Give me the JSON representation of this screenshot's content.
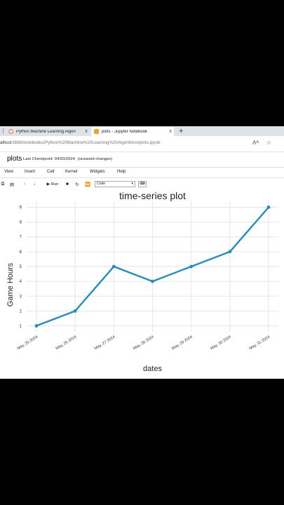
{
  "browser": {
    "tabs": [
      {
        "label": "Python Machine Learning Algori",
        "active": false
      },
      {
        "label": "plots - Jupyter Notebook",
        "active": true
      }
    ],
    "close_glyph": "x",
    "new_tab_glyph": "+",
    "url_prefix": "alhost",
    "url_path": ":8888/notebooks/Python%20Machine%20Learning%20Algorithms/plots.ipynb",
    "read_aloud_glyph": "Aᴬ",
    "favorite_glyph": "☆"
  },
  "notebook": {
    "name": "plots",
    "checkpoint": "Last Checkpoint: 04/20/2024",
    "status": "(unsaved changes)"
  },
  "menu": [
    "View",
    "Insert",
    "Cell",
    "Kernel",
    "Widgets",
    "Help"
  ],
  "toolbar": {
    "run_label": "Run",
    "cell_type": "Code"
  },
  "colors": {
    "line": "#1f8fbf",
    "grid": "#e6e6e6"
  },
  "chart_data": {
    "type": "line",
    "title": "time-series plot",
    "xlabel": "dates",
    "ylabel": "Game Hours",
    "x": [
      "May, 25 2024",
      "May, 26 2024",
      "May, 27 2024",
      "May, 28 2024",
      "May, 29 2024",
      "May, 30 2024",
      "May, 31 2024"
    ],
    "values": [
      1,
      2,
      5,
      4,
      5,
      6,
      9
    ],
    "yticks": [
      1,
      2,
      3,
      4,
      5,
      6,
      7,
      8,
      9
    ],
    "ylim": [
      0.6,
      9.4
    ],
    "grid": true,
    "legend": "none"
  }
}
